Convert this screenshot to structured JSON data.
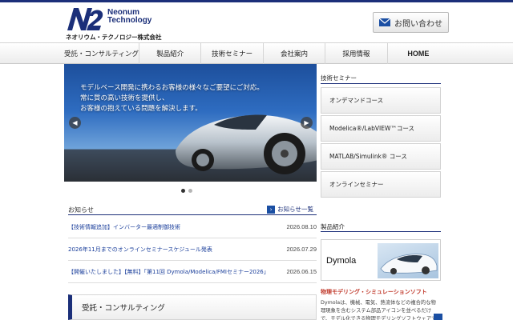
{
  "colors": {
    "brand": "#1b2f79",
    "link": "#1b3f9b",
    "accent_red": "#c0392b"
  },
  "header": {
    "logo_mark": "N2",
    "logo_name_line1": "Neonum",
    "logo_name_line2": "Technology",
    "company_name": "ネオリウム・テクノロジー株式会社",
    "contact_label": "お問い合わせ",
    "contact_icon": "mail-icon"
  },
  "nav": {
    "items": [
      {
        "label": "受託・コンサルティング"
      },
      {
        "label": "製品紹介"
      },
      {
        "label": "技術セミナー"
      },
      {
        "label": "会社案内"
      },
      {
        "label": "採用情報"
      },
      {
        "label": "HOME"
      }
    ]
  },
  "hero": {
    "line1": "モデルベース開発に携わるお客様の様々なご要望にご対応。",
    "line2": "常に質の高い技術を提供し、",
    "line3": "お客様の抱えている問題を解決します。",
    "slide_count": 2,
    "active_slide": 1
  },
  "news": {
    "title": "お知らせ",
    "more_label": "お知らせ一覧",
    "items": [
      {
        "text": "【技術情報追加】インバーター最適制御技術",
        "date": "2026.08.10"
      },
      {
        "text": "2026年11月までのオンラインセミナースケジュール発表",
        "date": "2026.07.29"
      },
      {
        "text": "【開催いたしました】【無料】「第11回 Dymola/Modelica/FMIセミナー2026」",
        "date": "2026.06.15"
      }
    ]
  },
  "consulting": {
    "title": "受託・コンサルティング"
  },
  "sidebar": {
    "seminar_title": "技術セミナー",
    "seminar_items": [
      {
        "label": "オンデマンドコース"
      },
      {
        "label": "Modelica®/LabVIEW™コース"
      },
      {
        "label": "MATLAB/Simulink® コース"
      },
      {
        "label": "オンラインセミナー"
      }
    ],
    "product_title": "製品紹介",
    "product_name": "Dymola",
    "product_subtitle": "物理モデリング・シミュレーションソフト",
    "product_desc": "Dymolaは、機械、電気、熱流体などの複合的な物理現象を含むシステム部品アイコンを並べるだけで、モデル化できる物理モデリングソフトウェアです。"
  }
}
